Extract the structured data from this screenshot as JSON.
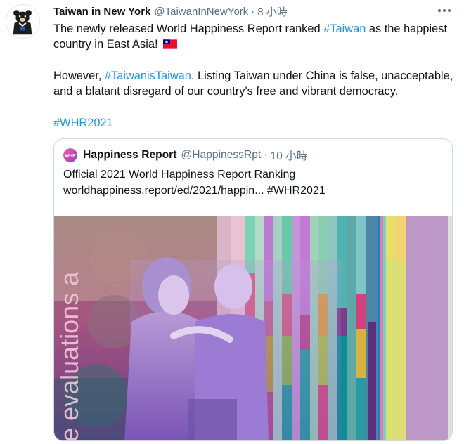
{
  "tweet": {
    "display_name": "Taiwan in New York",
    "handle": "@TaiwanInNewYork",
    "separator": "·",
    "time": "8 小時",
    "more_icon": "more-horizontal-icon",
    "paragraphs": [
      [
        "The newly released World Happiness Report ranked ",
        "#Taiwan",
        " as the happiest country in East Asia! "
      ],
      [
        "However, ",
        "#TaiwanisTaiwan",
        ". Listing Taiwan under China is false, unacceptable, and a blatant disregard of our country's free and vibrant democracy."
      ],
      [
        "#WHR2021"
      ]
    ],
    "flag": "taiwan-flag-emoji"
  },
  "quote": {
    "display_name": "Happiness Report",
    "handle": "@HappinessRpt",
    "separator": "·",
    "time": "10 小時",
    "text_line1": "Official 2021 World Happiness Report Ranking",
    "text_line2": "worldhappiness.report/ed/2021/happin... #WHR2021",
    "avatar_text": "WHR",
    "media_text": "e evaluations a"
  },
  "colors": {
    "link": "#1b95e0",
    "muted": "#5b7083",
    "border": "#cfd9de"
  }
}
